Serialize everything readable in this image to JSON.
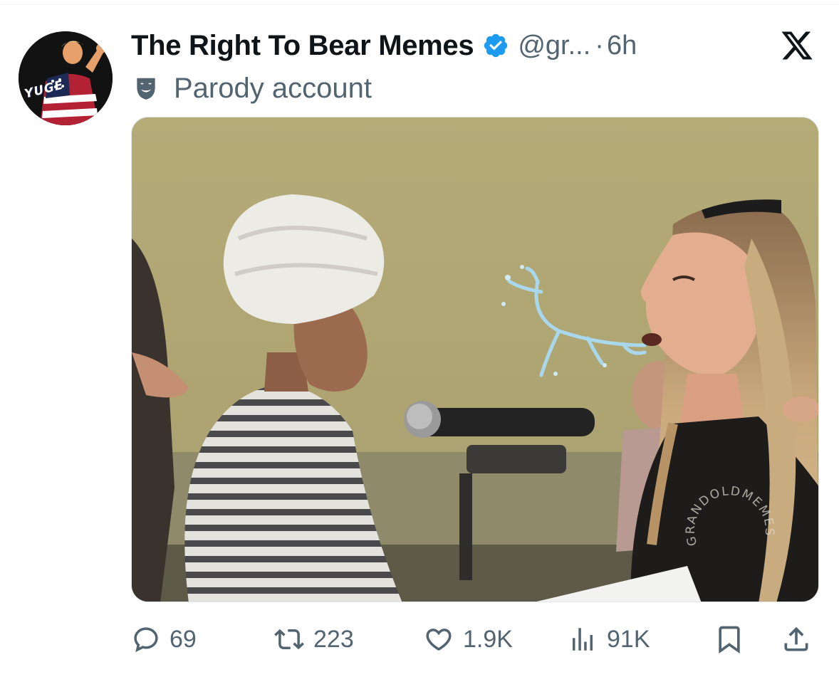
{
  "tweet": {
    "author": {
      "display_name": "The Right To Bear Memes",
      "handle": "@gr...",
      "separator": "·",
      "time": "6h",
      "avatar_text": "YUGE",
      "verified_icon": "verified-badge-icon"
    },
    "parody_label": "Parody account",
    "media": {
      "watermark_text": "GRANDOLDMEMES ©"
    },
    "actions": {
      "replies": "69",
      "reposts": "223",
      "likes": "1.9K",
      "views": "91K"
    }
  },
  "icons": {
    "reply": "reply-icon",
    "repost": "repost-icon",
    "like": "heart-icon",
    "views": "views-icon",
    "bookmark": "bookmark-icon",
    "share": "share-icon",
    "close": "x-logo-icon",
    "parody": "parody-mask-icon"
  },
  "colors": {
    "text_primary": "#0f1419",
    "text_secondary": "#536471",
    "verified_blue": "#1d9bf0"
  }
}
